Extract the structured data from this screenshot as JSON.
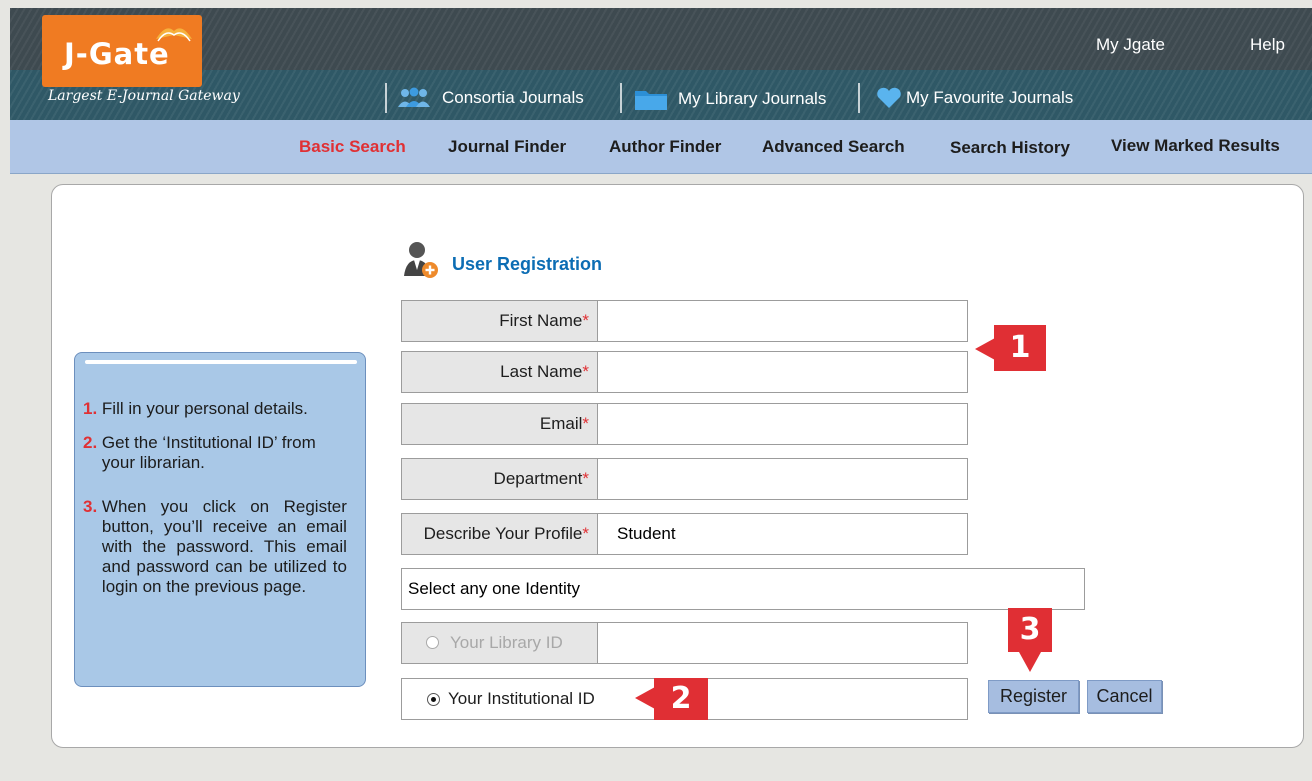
{
  "brand": {
    "name": "J-Gate",
    "tagline": "Largest E-Journal Gateway",
    "logo_color": "#f07b22"
  },
  "header": {
    "top_links": [
      "My Jgate",
      "Help"
    ],
    "library_links": [
      {
        "label": "Consortia Journals",
        "icon": "consortia-people-icon"
      },
      {
        "label": "My Library Journals",
        "icon": "folder-icon"
      },
      {
        "label": "My Favourite Journals",
        "icon": "heart-icon"
      }
    ]
  },
  "nav": {
    "items": [
      "Basic Search",
      "Journal Finder",
      "Author Finder",
      "Advanced Search",
      "Search History",
      "View Marked Results"
    ],
    "active": "Basic Search",
    "active_color": "#e03034"
  },
  "instructions": {
    "steps": [
      {
        "num": "1.",
        "text": "Fill in your personal details."
      },
      {
        "num": "2.",
        "text": "Get the ‘Institutional ID’ from your librarian."
      },
      {
        "num": "3.",
        "text": "When you click on Register button, you’ll receive an email with the password. This email and password can be utilized to login on the previous page."
      }
    ]
  },
  "form": {
    "title": "User Registration",
    "title_icon": "user-add-icon",
    "fields": [
      {
        "label": "First Name",
        "required_mark": "*",
        "value": ""
      },
      {
        "label": "Last Name",
        "required_mark": "*",
        "value": ""
      },
      {
        "label": "Email",
        "required_mark": "*",
        "value": ""
      },
      {
        "label": "Department",
        "required_mark": "*",
        "value": ""
      },
      {
        "label": "Describe Your Profile",
        "required_mark": "*",
        "value": "Student"
      }
    ],
    "identity_prompt": "Select any one Identity",
    "library_id": {
      "label": "Your Library ID",
      "selected": false,
      "value": ""
    },
    "institutional_id": {
      "label": "Your Institutional ID",
      "selected": true
    },
    "buttons": {
      "register": "Register",
      "cancel": "Cancel"
    }
  },
  "callouts": [
    "1",
    "2",
    "3"
  ],
  "callout_color": "#e02f34"
}
